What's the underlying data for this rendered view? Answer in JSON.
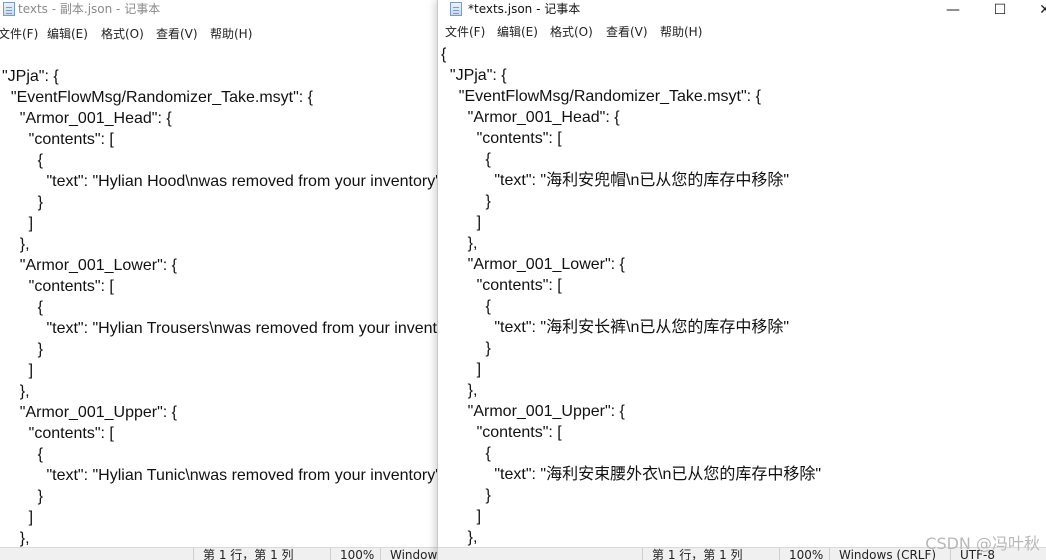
{
  "back_window": {
    "title": "texts - 副本.json - 记事本",
    "menu": [
      "文件(F)",
      "编辑(E)",
      "格式(O)",
      "查看(V)",
      "帮助(H)"
    ],
    "lines": [
      "\"JPja\": {",
      "  \"EventFlowMsg/Randomizer_Take.msyt\": {",
      "    \"Armor_001_Head\": {",
      "      \"contents\": [",
      "        {",
      "          \"text\": \"Hylian Hood\\nwas removed from your inventory\"",
      "        }",
      "      ]",
      "    },",
      "    \"Armor_001_Lower\": {",
      "      \"contents\": [",
      "        {",
      "          \"text\": \"Hylian Trousers\\nwas removed from your inventory\"",
      "        }",
      "      ]",
      "    },",
      "    \"Armor_001_Upper\": {",
      "      \"contents\": [",
      "        {",
      "          \"text\": \"Hylian Tunic\\nwas removed from your inventory\"",
      "        }",
      "      ]",
      "    },"
    ],
    "status": [
      "第 1 行，第 1 列",
      "100%",
      "Windows"
    ]
  },
  "front_window": {
    "title": "*texts.json - 记事本",
    "controls": {
      "minimize": "—",
      "maximize": "☐",
      "close": "✕"
    },
    "menu": [
      "文件(F)",
      "编辑(E)",
      "格式(O)",
      "查看(V)",
      "帮助(H)"
    ],
    "lines": [
      "{",
      "  \"JPja\": {",
      "    \"EventFlowMsg/Randomizer_Take.msyt\": {",
      "      \"Armor_001_Head\": {",
      "        \"contents\": [",
      "          {",
      "            \"text\": \"海利安兜帽\\n已从您的库存中移除\"",
      "          }",
      "        ]",
      "      },",
      "      \"Armor_001_Lower\": {",
      "        \"contents\": [",
      "          {",
      "            \"text\": \"海利安长裤\\n已从您的库存中移除\"",
      "          }",
      "        ]",
      "      },",
      "      \"Armor_001_Upper\": {",
      "        \"contents\": [",
      "          {",
      "            \"text\": \"海利安束腰外衣\\n已从您的库存中移除\"",
      "          }",
      "        ]",
      "      },"
    ],
    "status": [
      "第 1 行，第 1 列",
      "100%",
      "Windows (CRLF)",
      "UTF-8"
    ]
  },
  "watermark": "CSDN @冯叶秋"
}
